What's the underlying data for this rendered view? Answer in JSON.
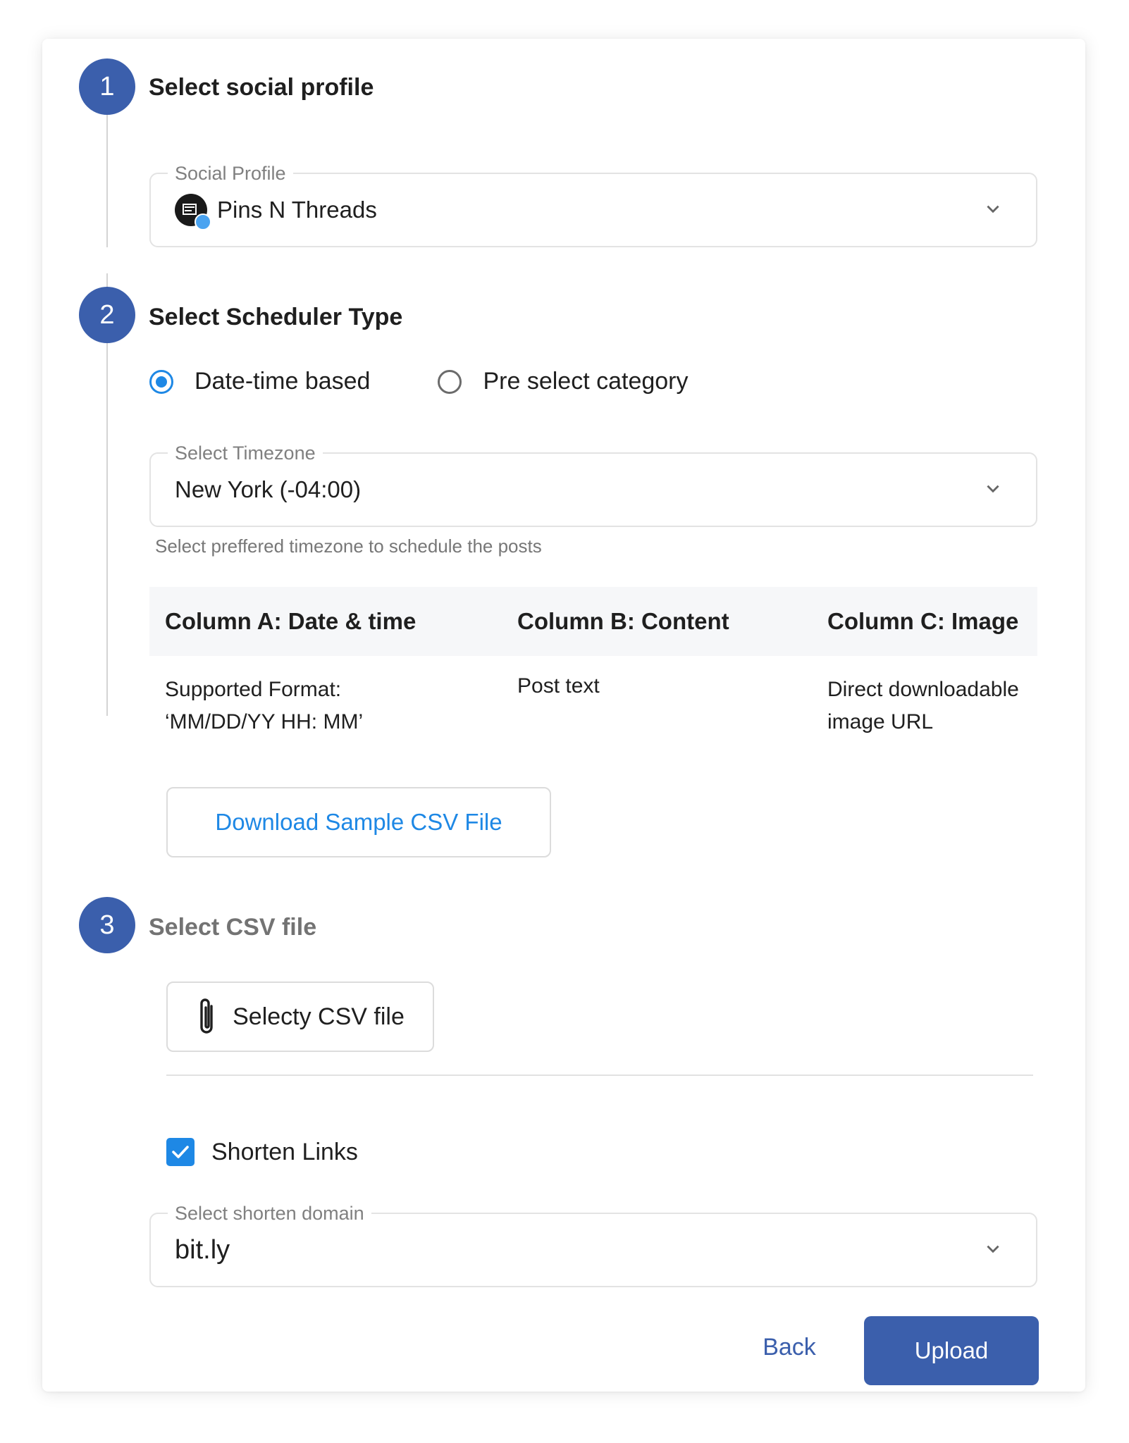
{
  "steps": [
    {
      "number": "1",
      "title": "Select social profile"
    },
    {
      "number": "2",
      "title": "Select Scheduler Type"
    },
    {
      "number": "3",
      "title": "Select CSV file"
    }
  ],
  "social_profile": {
    "legend": "Social Profile",
    "value": "Pins N Threads"
  },
  "scheduler_type": {
    "options": [
      {
        "label": "Date-time based",
        "checked": true
      },
      {
        "label": "Pre select category",
        "checked": false
      }
    ]
  },
  "timezone": {
    "legend": "Select Timezone",
    "value": "New York (-04:00)",
    "helper": "Select preffered timezone to schedule the posts"
  },
  "columns_table": {
    "headers": [
      "Column A: Date & time",
      "Column B: Content",
      "Column C: Image"
    ],
    "row": {
      "a_line1": "Supported Format:",
      "a_line2": "‘MM/DD/YY HH: MM’",
      "b": "Post text",
      "c_line1": "Direct downloadable",
      "c_line2": "image URL"
    }
  },
  "download_sample_label": "Download Sample CSV File",
  "select_csv_label": "Selecty CSV file",
  "shorten_links": {
    "label": "Shorten Links",
    "checked": true
  },
  "shorten_domain": {
    "legend": "Select shorten domain",
    "value": "bit.ly"
  },
  "actions": {
    "back_label": "Back",
    "upload_label": "Upload"
  },
  "colors": {
    "primary": "#3b5fac",
    "accent_blue": "#1e88e5"
  }
}
